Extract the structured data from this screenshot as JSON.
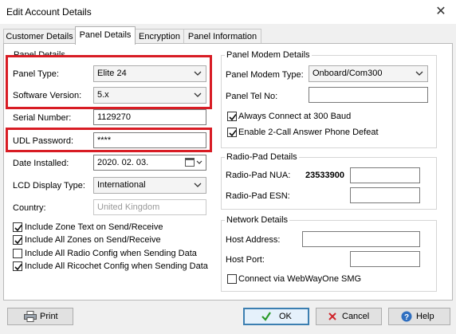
{
  "window": {
    "title": "Edit Account Details"
  },
  "tabs": [
    {
      "label": "Customer Details"
    },
    {
      "label": "Panel Details"
    },
    {
      "label": "Encryption"
    },
    {
      "label": "Panel Information"
    }
  ],
  "panel_details": {
    "group_title": "Panel Details",
    "panel_type": {
      "label": "Panel Type:",
      "value": "Elite 24"
    },
    "software_version": {
      "label": "Software Version:",
      "value": "5.x"
    },
    "serial_number": {
      "label": "Serial Number:",
      "value": "1129270"
    },
    "udl_password": {
      "label": "UDL Password:",
      "value": "****"
    },
    "date_installed": {
      "label": "Date Installed:",
      "value": "2020. 02. 03."
    },
    "lcd_display_type": {
      "label": "LCD Display Type:",
      "value": "International"
    },
    "country": {
      "label": "Country:",
      "value": "United Kingdom"
    },
    "checkboxes": [
      {
        "label": "Include Zone Text on Send/Receive",
        "checked": true
      },
      {
        "label": "Include All Zones on Send/Receive",
        "checked": true
      },
      {
        "label": "Include All Radio Config when Sending Data",
        "checked": false
      },
      {
        "label": "Include All Ricochet Config when Sending Data",
        "checked": true
      }
    ]
  },
  "panel_modem": {
    "group_title": "Panel Modem Details",
    "modem_type": {
      "label": "Panel Modem Type:",
      "value": "Onboard/Com300"
    },
    "tel_no": {
      "label": "Panel Tel No:",
      "value": ""
    },
    "checkboxes": [
      {
        "label": "Always Connect at 300 Baud",
        "checked": true
      },
      {
        "label": "Enable 2-Call Answer Phone Defeat",
        "checked": true
      }
    ]
  },
  "radio_pad": {
    "group_title": "Radio-Pad Details",
    "nua": {
      "label": "Radio-Pad NUA:",
      "value": "23533900"
    },
    "esn": {
      "label": "Radio-Pad ESN:",
      "value": ""
    }
  },
  "network": {
    "group_title": "Network Details",
    "host_address": {
      "label": "Host Address:",
      "value": ""
    },
    "host_port": {
      "label": "Host Port:",
      "value": ""
    },
    "webwayone": {
      "label": "Connect via WebWayOne SMG",
      "checked": false
    }
  },
  "buttons": {
    "print": "Print",
    "ok": "OK",
    "cancel": "Cancel",
    "help": "Help"
  },
  "colors": {
    "highlight_red": "#d81c24",
    "ok_border": "#3c7fb1"
  }
}
